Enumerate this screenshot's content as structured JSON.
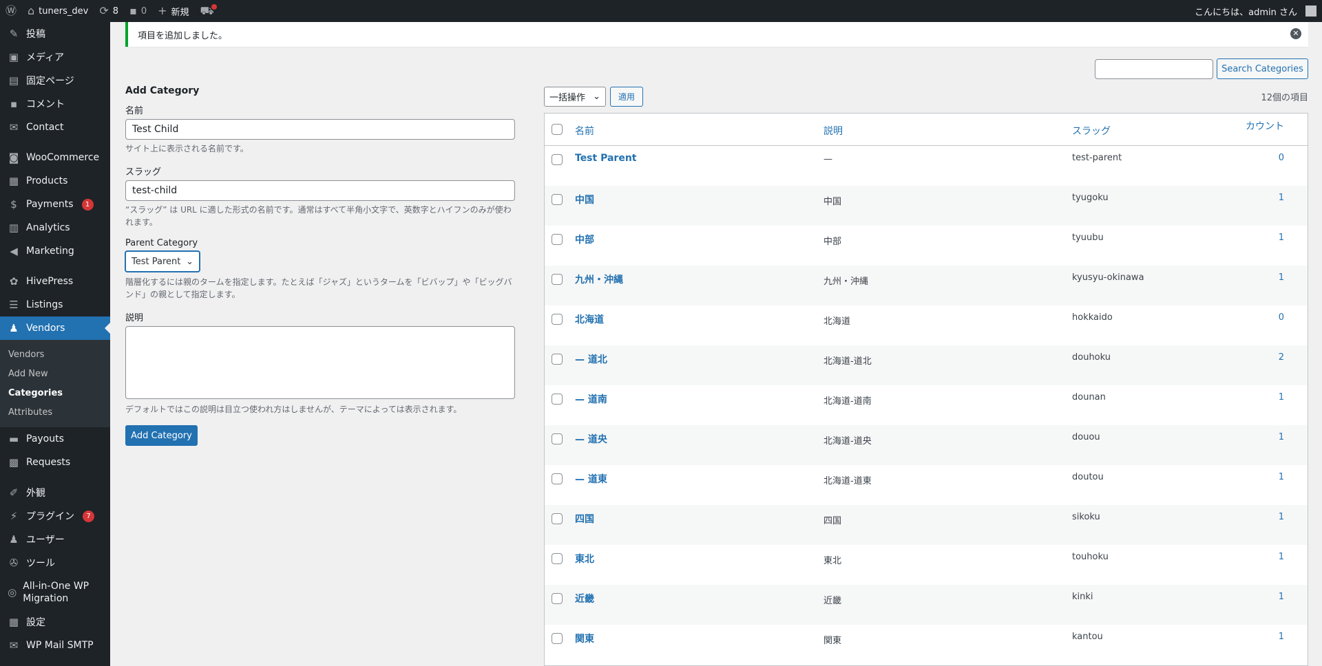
{
  "adminbar": {
    "site_name": "tuners_dev",
    "updates_count": "8",
    "comments_count": "0",
    "new_label": "新規",
    "greeting": "こんにちは、admin さん"
  },
  "sidebar": {
    "items_top": [
      {
        "label": "投稿",
        "icon": "pin-icon"
      },
      {
        "label": "メディア",
        "icon": "media-icon"
      },
      {
        "label": "固定ページ",
        "icon": "page-icon"
      },
      {
        "label": "コメント",
        "icon": "comment-icon"
      },
      {
        "label": "Contact",
        "icon": "mail-icon"
      }
    ],
    "items_woo": [
      {
        "label": "WooCommerce",
        "icon": "woo-icon"
      },
      {
        "label": "Products",
        "icon": "archive-icon"
      },
      {
        "label": "Payments",
        "icon": "dollar-icon",
        "badge": "1"
      },
      {
        "label": "Analytics",
        "icon": "chart-icon"
      },
      {
        "label": "Marketing",
        "icon": "megaphone-icon"
      }
    ],
    "items_hive": [
      {
        "label": "HivePress",
        "icon": "hive-icon"
      },
      {
        "label": "Listings",
        "icon": "list-icon"
      },
      {
        "label": "Vendors",
        "icon": "user-icon"
      }
    ],
    "submenu": [
      "Vendors",
      "Add New",
      "Categories",
      "Attributes"
    ],
    "items_after": [
      {
        "label": "Payouts",
        "icon": "payout-icon"
      },
      {
        "label": "Requests",
        "icon": "requests-icon"
      }
    ],
    "items_bottom": [
      {
        "label": "外観",
        "icon": "brush-icon"
      },
      {
        "label": "プラグイン",
        "icon": "plugin-icon",
        "badge": "7"
      },
      {
        "label": "ユーザー",
        "icon": "users-icon"
      },
      {
        "label": "ツール",
        "icon": "wrench-icon"
      },
      {
        "label": "All-in-One WP Migration",
        "icon": "migration-icon"
      },
      {
        "label": "設定",
        "icon": "settings-icon"
      },
      {
        "label": "WP Mail SMTP",
        "icon": "smtp-icon"
      }
    ]
  },
  "notice": {
    "text": "項目を追加しました。"
  },
  "search": {
    "button": "Search Categories",
    "value": ""
  },
  "form": {
    "heading": "Add Category",
    "name_label": "名前",
    "name_value": "Test Child",
    "name_desc": "サイト上に表示される名前です。",
    "slug_label": "スラッグ",
    "slug_value": "test-child",
    "slug_desc": "“スラッグ” は URL に適した形式の名前です。通常はすべて半角小文字で、英数字とハイフンのみが使われます。",
    "parent_label": "Parent Category",
    "parent_value": "Test Parent",
    "parent_desc": "階層化するには親のタームを指定します。たとえば「ジャズ」というタームを「ビバップ」や「ビッグバンド」の親として指定します。",
    "desc_label": "説明",
    "desc_desc": "デフォルトではこの説明は目立つ使われ方はしませんが、テーマによっては表示されます。",
    "submit": "Add Category"
  },
  "bulk": {
    "select": "一括操作",
    "apply": "適用",
    "count": "12個の項目"
  },
  "table": {
    "headers": {
      "name": "名前",
      "description": "説明",
      "slug": "スラッグ",
      "count": "カウント"
    },
    "rows": [
      {
        "name": "Test Parent",
        "description": "—",
        "slug": "test-parent",
        "count": "0"
      },
      {
        "name": "中国",
        "description": "中国",
        "slug": "tyugoku",
        "count": "1"
      },
      {
        "name": "中部",
        "description": "中部",
        "slug": "tyuubu",
        "count": "1"
      },
      {
        "name": "九州・沖縄",
        "description": "九州・沖縄",
        "slug": "kyusyu-okinawa",
        "count": "1"
      },
      {
        "name": "北海道",
        "description": "北海道",
        "slug": "hokkaido",
        "count": "0"
      },
      {
        "name": "— 道北",
        "description": "北海道-道北",
        "slug": "douhoku",
        "count": "2"
      },
      {
        "name": "— 道南",
        "description": "北海道-道南",
        "slug": "dounan",
        "count": "1"
      },
      {
        "name": "— 道央",
        "description": "北海道-道央",
        "slug": "douou",
        "count": "1"
      },
      {
        "name": "— 道東",
        "description": "北海道-道東",
        "slug": "doutou",
        "count": "1"
      },
      {
        "name": "四国",
        "description": "四国",
        "slug": "sikoku",
        "count": "1"
      },
      {
        "name": "東北",
        "description": "東北",
        "slug": "touhoku",
        "count": "1"
      },
      {
        "name": "近畿",
        "description": "近畿",
        "slug": "kinki",
        "count": "1"
      },
      {
        "name": "関東",
        "description": "関東",
        "slug": "kantou",
        "count": "1"
      }
    ]
  }
}
